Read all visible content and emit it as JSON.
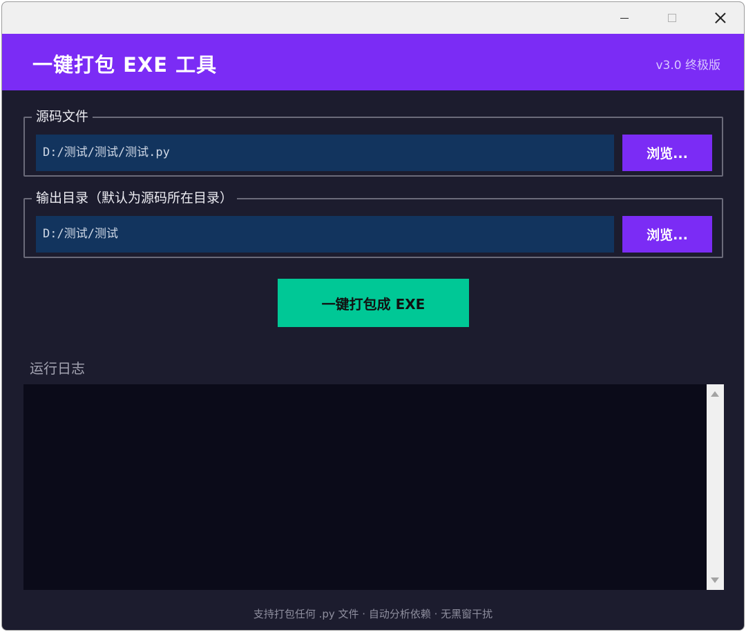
{
  "header": {
    "title": "一键打包 EXE 工具",
    "version": "v3.0 终极版"
  },
  "source_group": {
    "legend": "源码文件",
    "path_value": "D:/测试/测试/测试.py",
    "browse_label": "浏览..."
  },
  "output_group": {
    "legend": "输出目录（默认为源码所在目录）",
    "path_value": "D:/测试/测试",
    "browse_label": "浏览..."
  },
  "pack_button": "一键打包成 EXE",
  "log": {
    "label": "运行日志",
    "content": ""
  },
  "footer": "支持打包任何 .py 文件 · 自动分析依赖 · 无黑窗干扰",
  "colors": {
    "header": "#7b2cf5",
    "background": "#1c1c2e",
    "field": "#12345e",
    "browse": "#7b2cf5",
    "pack": "#00c896",
    "log": "#0b0b19"
  },
  "icons": {
    "minimize": "minimize-icon",
    "maximize": "maximize-icon",
    "close": "close-icon",
    "scroll_up": "arrow-up-icon",
    "scroll_down": "arrow-down-icon"
  }
}
